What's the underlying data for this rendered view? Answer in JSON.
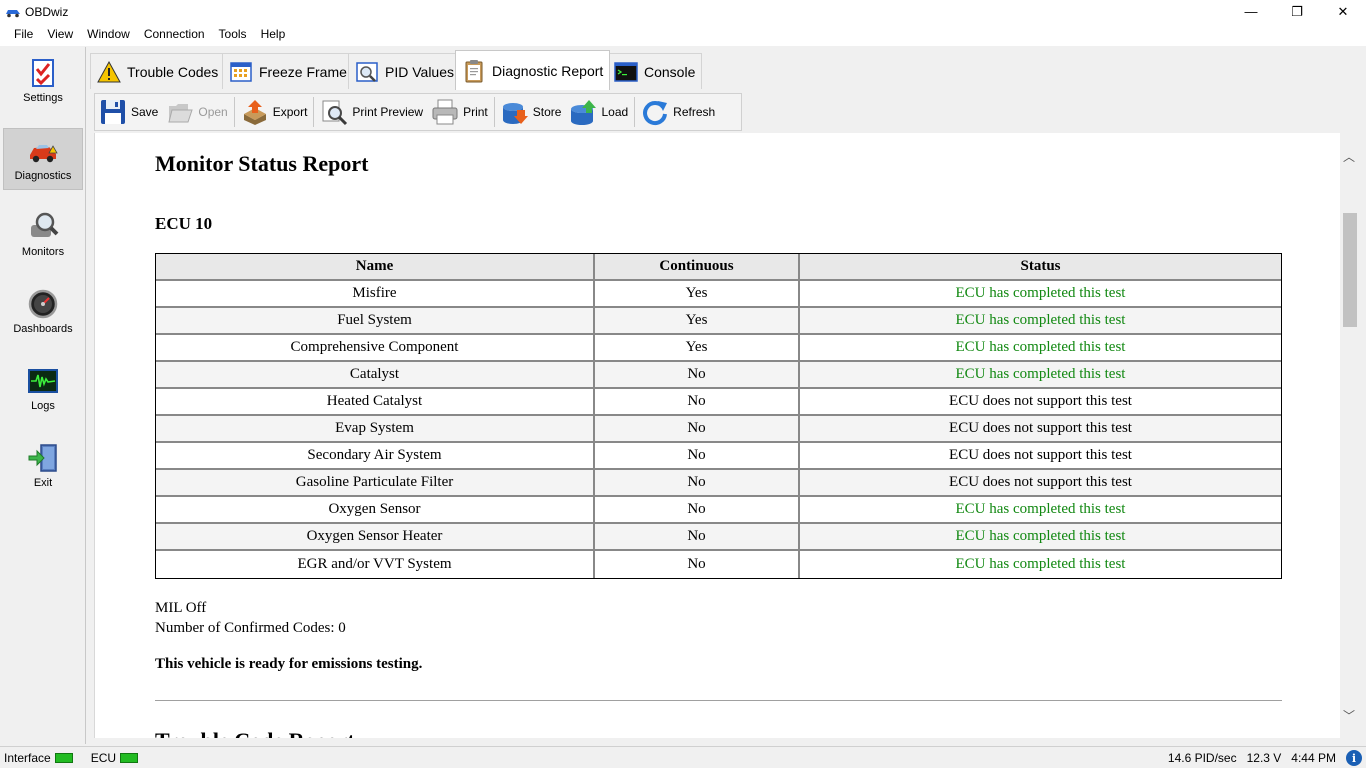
{
  "window": {
    "title": "OBDwiz",
    "minimize": "—",
    "restore": "❐",
    "close": "✕"
  },
  "menu": [
    "File",
    "View",
    "Window",
    "Connection",
    "Tools",
    "Help"
  ],
  "sidebar": {
    "items": [
      {
        "label": "Settings",
        "icon": "checklist-icon",
        "active": false
      },
      {
        "label": "Diagnostics",
        "icon": "car-warning-icon",
        "active": true
      },
      {
        "label": "Monitors",
        "icon": "magnifier-icon",
        "active": false
      },
      {
        "label": "Dashboards",
        "icon": "gauge-icon",
        "active": false
      },
      {
        "label": "Logs",
        "icon": "waveform-icon",
        "active": false
      },
      {
        "label": "Exit",
        "icon": "exit-door-icon",
        "active": false
      }
    ]
  },
  "tabs": [
    {
      "label": "Trouble Codes",
      "icon": "warning-triangle-icon",
      "active": false
    },
    {
      "label": "Freeze Frame",
      "icon": "freeze-frame-icon",
      "active": false
    },
    {
      "label": "PID Values",
      "icon": "pid-values-icon",
      "active": false
    },
    {
      "label": "Diagnostic Report",
      "icon": "clipboard-icon",
      "active": true
    },
    {
      "label": "Console",
      "icon": "console-icon",
      "active": false
    }
  ],
  "toolbar": {
    "save": "Save",
    "open": "Open",
    "export": "Export",
    "print_preview": "Print Preview",
    "print": "Print",
    "store": "Store",
    "load": "Load",
    "refresh": "Refresh"
  },
  "report": {
    "title": "Monitor Status Report",
    "ecu_heading": "ECU 10",
    "columns": [
      "Name",
      "Continuous",
      "Status"
    ],
    "rows": [
      {
        "name": "Misfire",
        "continuous": "Yes",
        "status": "ECU has completed this test",
        "complete": true
      },
      {
        "name": "Fuel System",
        "continuous": "Yes",
        "status": "ECU has completed this test",
        "complete": true
      },
      {
        "name": "Comprehensive Component",
        "continuous": "Yes",
        "status": "ECU has completed this test",
        "complete": true
      },
      {
        "name": "Catalyst",
        "continuous": "No",
        "status": "ECU has completed this test",
        "complete": true
      },
      {
        "name": "Heated Catalyst",
        "continuous": "No",
        "status": "ECU does not support this test",
        "complete": false
      },
      {
        "name": "Evap System",
        "continuous": "No",
        "status": "ECU does not support this test",
        "complete": false
      },
      {
        "name": "Secondary Air System",
        "continuous": "No",
        "status": "ECU does not support this test",
        "complete": false
      },
      {
        "name": "Gasoline Particulate Filter",
        "continuous": "No",
        "status": "ECU does not support this test",
        "complete": false
      },
      {
        "name": "Oxygen Sensor",
        "continuous": "No",
        "status": "ECU has completed this test",
        "complete": true
      },
      {
        "name": "Oxygen Sensor Heater",
        "continuous": "No",
        "status": "ECU has completed this test",
        "complete": true
      },
      {
        "name": "EGR and/or VVT System",
        "continuous": "No",
        "status": "ECU has completed this test",
        "complete": true
      }
    ],
    "mil": "MIL Off",
    "confirmed_codes": "Number of Confirmed Codes: 0",
    "ready_message": "This vehicle is ready for emissions testing.",
    "next_section_title": "Trouble Code Report"
  },
  "status_colors": {
    "complete": "#118811",
    "unsupported": "#000000",
    "led_on": "#22bb22"
  },
  "statusbar": {
    "interface_label": "Interface",
    "ecu_label": "ECU",
    "pid_rate": "14.6 PID/sec",
    "voltage": "12.3 V",
    "time": "4:44 PM",
    "info": "i"
  }
}
